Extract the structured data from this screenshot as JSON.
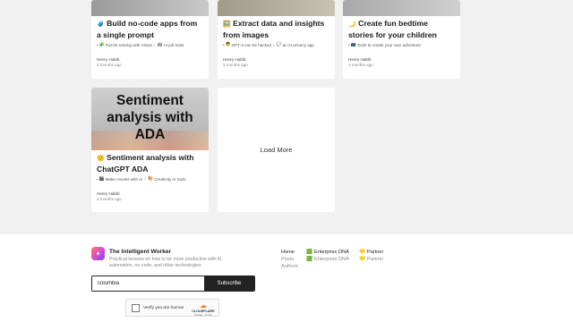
{
  "cards": [
    {
      "title_emoji": "🧳",
      "title": "Build no-code apps from a single prompt",
      "tags": [
        {
          "icon": "🧩",
          "label": "Puzzle solving with Vision"
        },
        {
          "icon": "🤖",
          "label": "AI job tools"
        }
      ],
      "author": "Henry Habib",
      "date": "3 months ago"
    },
    {
      "title_emoji": "🖼️",
      "title": "Extract data and insights from images",
      "tags": [
        {
          "icon": "👨",
          "label": "GPT-4 can be hacked"
        },
        {
          "icon": "💬",
          "label": "an AI privacy app"
        }
      ],
      "author": "Henry Habib",
      "date": "3 months ago"
    },
    {
      "title_emoji": "🌙",
      "title": "Create fun bedtime stories for your children",
      "tags": [
        {
          "icon": "📺",
          "label": "Tools to create your own adventure"
        }
      ],
      "author": "Henry Habib",
      "date": "3 months ago"
    },
    {
      "image_text": "Sentiment analysis with ADA",
      "title_emoji": "🙂",
      "title": "Sentiment analysis with ChatGPT ADA",
      "tags": [
        {
          "icon": "🎬",
          "label": "Make movies with AI"
        },
        {
          "icon": "🎨",
          "label": "Creativity AI tools"
        }
      ],
      "author": "Henry Habib",
      "date": "3 months ago"
    }
  ],
  "load_more_label": "Load More",
  "footer": {
    "brand_name": "The Intelligent Worker",
    "brand_desc": "Practical lessons on how to be more productive with AI, automation, no-code, and other technologies",
    "subscribe": {
      "input_value": "columbia",
      "button_label": "Subscribe"
    },
    "captcha": {
      "label": "Verify you are human",
      "brand": "CLOUDFLARE",
      "links": "Privacy · Terms"
    },
    "nav": {
      "col1": [
        "Home",
        "Posts",
        "Authors"
      ],
      "col2": [
        {
          "icon": "🟩",
          "label": "Enterprise DNA"
        },
        {
          "icon": "🟩",
          "label": "Enterprise DNA"
        }
      ],
      "col3": [
        {
          "icon": "💛",
          "label": "Partner"
        },
        {
          "icon": "💛",
          "label": "Partner"
        }
      ]
    }
  }
}
